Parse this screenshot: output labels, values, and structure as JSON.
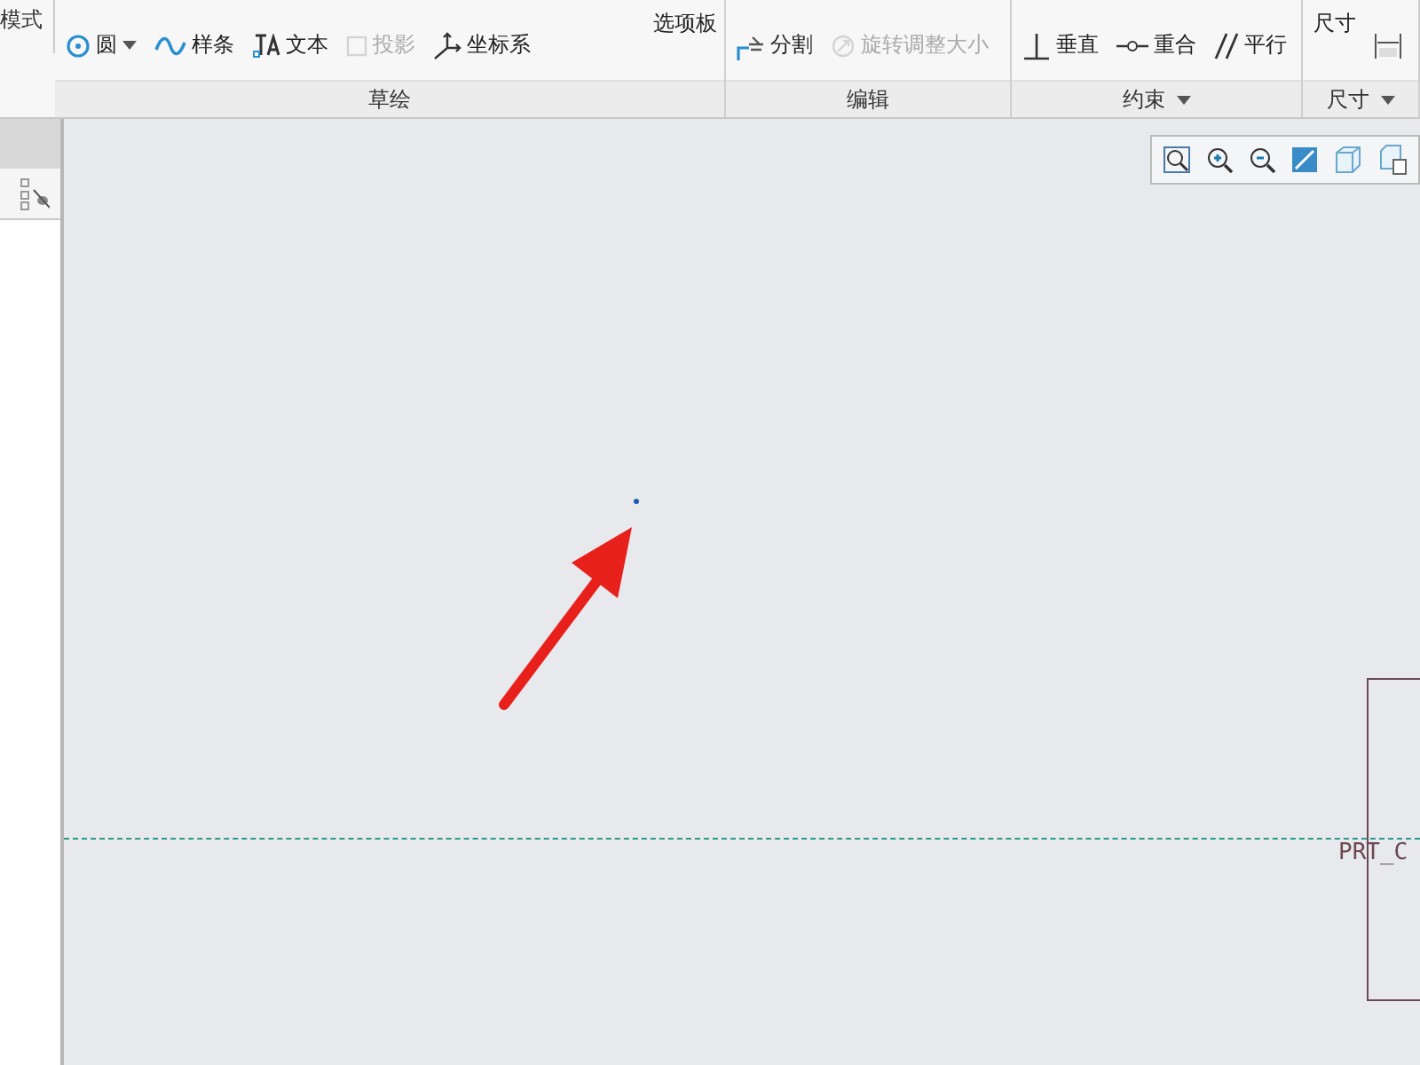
{
  "ribbon": {
    "mode_label": "模式",
    "groups": [
      {
        "label": "草绘",
        "has_menu": false,
        "tools": [
          {
            "label": "圆",
            "dropdown": true,
            "disabled": false
          },
          {
            "label": "样条",
            "dropdown": false,
            "disabled": false
          },
          {
            "label": "文本",
            "dropdown": false,
            "disabled": false
          },
          {
            "label": "投影",
            "dropdown": false,
            "disabled": true
          },
          {
            "label": "坐标系",
            "dropdown": false,
            "disabled": false
          }
        ],
        "large_button": "选项板"
      },
      {
        "label": "编辑",
        "has_menu": false,
        "tools": [
          {
            "label": "分割",
            "dropdown": false,
            "disabled": false
          },
          {
            "label": "旋转调整大小",
            "dropdown": false,
            "disabled": true
          }
        ]
      },
      {
        "label": "约束",
        "has_menu": true,
        "tools": [
          {
            "label": "垂直",
            "dropdown": false,
            "disabled": false
          },
          {
            "label": "重合",
            "dropdown": false,
            "disabled": false
          },
          {
            "label": "平行",
            "dropdown": false,
            "disabled": false
          }
        ]
      },
      {
        "label": "尺寸",
        "has_menu": true,
        "large_button": "尺寸",
        "tools": [
          {
            "dropdown": false,
            "disabled": false
          }
        ]
      }
    ]
  },
  "canvas": {
    "datum_label": "PRT_C"
  }
}
